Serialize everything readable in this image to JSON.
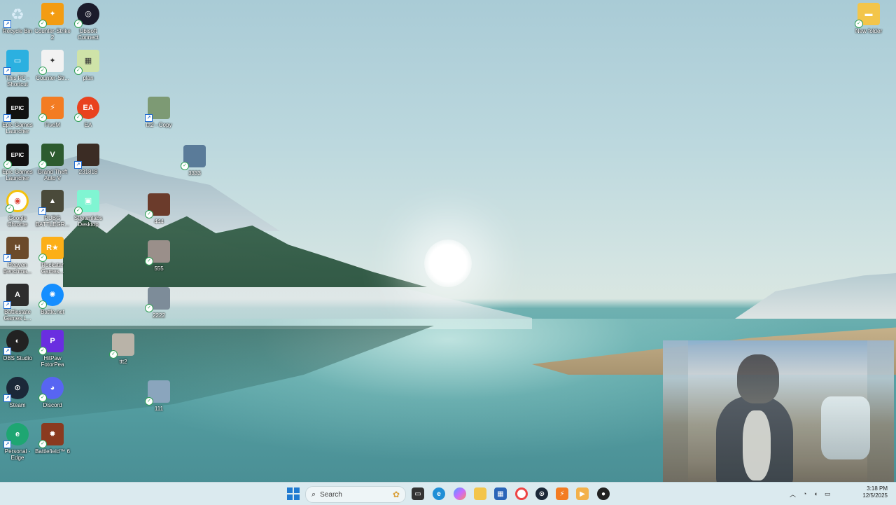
{
  "desktop": {
    "icons": [
      {
        "id": "recycle-bin",
        "label": "Recycle Bin",
        "icon": "recycle-bin-icon",
        "color": "#6aa8d8"
      },
      {
        "id": "counter-strike-2",
        "label": "Counter-Strike 2",
        "icon": "counter-strike-icon",
        "color": "#f39c12"
      },
      {
        "id": "ubisoft-connect",
        "label": "Ubisoft Connect",
        "icon": "ubisoft-swirl-icon",
        "color": "#1b1b2b"
      },
      {
        "id": "this-pc",
        "label": "This PC - Shortcut",
        "icon": "monitor-icon",
        "color": "#2bb0e0"
      },
      {
        "id": "counter-strike",
        "label": "Counter-Str...",
        "icon": "counter-strike-icon",
        "color": "#f2f2f2"
      },
      {
        "id": "plan",
        "label": "plan",
        "icon": "checker-image-icon",
        "color": "#cfe3a8"
      },
      {
        "id": "epic-games-1",
        "label": "Epic Games Launcher",
        "icon": "epic-games-icon",
        "color": "#111111"
      },
      {
        "id": "fivem",
        "label": "FiveM",
        "icon": "fivem-icon",
        "color": "#f37c22"
      },
      {
        "id": "ea",
        "label": "EA",
        "icon": "ea-icon",
        "color": "#e9421e"
      },
      {
        "id": "ttt2-copy",
        "label": "ttt2 - Copy",
        "icon": "photo-thumb-icon",
        "color": "#7d9a74"
      },
      {
        "id": "epic-games-2",
        "label": "Epic Games Launcher",
        "icon": "epic-games-icon",
        "color": "#111111"
      },
      {
        "id": "gta-v",
        "label": "Grand Theft Auto V",
        "icon": "gta-icon",
        "color": "#2d5b2f"
      },
      {
        "id": "231818",
        "label": "231818",
        "icon": "photo-thumb-icon",
        "color": "#3b2c24"
      },
      {
        "id": "3333",
        "label": "3333",
        "icon": "photo-thumb-icon",
        "color": "#5a7b99"
      },
      {
        "id": "google-chrome",
        "label": "Google Chrome",
        "icon": "chrome-icon",
        "color": "#ffffff"
      },
      {
        "id": "pubg",
        "label": "PUBG BATTLEGR...",
        "icon": "pubg-icon",
        "color": "#4a4a3a"
      },
      {
        "id": "streamlabs",
        "label": "Streamlabs Desktop",
        "icon": "streamlabs-icon",
        "color": "#80f5d2"
      },
      {
        "id": "444",
        "label": "444",
        "icon": "photo-thumb-icon",
        "color": "#6b3b2b"
      },
      {
        "id": "heaven",
        "label": "Heaven Benchma...",
        "icon": "heaven-icon",
        "color": "#6b4a2a"
      },
      {
        "id": "rockstar",
        "label": "Rockstar Games...",
        "icon": "rockstar-icon",
        "color": "#fcaf17"
      },
      {
        "id": "555",
        "label": "555",
        "icon": "photo-thumb-icon",
        "color": "#9a8f8a"
      },
      {
        "id": "battlestate",
        "label": "Battlestate Games L...",
        "icon": "battlestate-icon",
        "color": "#2d2d2d"
      },
      {
        "id": "battlenet",
        "label": "Battle.net",
        "icon": "battlenet-icon",
        "color": "#148eff"
      },
      {
        "id": "2222",
        "label": "2222",
        "icon": "photo-thumb-icon",
        "color": "#7d8c99"
      },
      {
        "id": "obs",
        "label": "OBS Studio",
        "icon": "obs-icon",
        "color": "#222222"
      },
      {
        "id": "hitpaw",
        "label": "HitPaw FotorPea",
        "icon": "hitpaw-icon",
        "color": "#6a2ee0"
      },
      {
        "id": "ttt2",
        "label": "ttt2",
        "icon": "photo-thumb-icon",
        "color": "#b9b3a8"
      },
      {
        "id": "steam",
        "label": "Steam",
        "icon": "steam-icon",
        "color": "#1b2838"
      },
      {
        "id": "discord",
        "label": "Discord",
        "icon": "discord-icon",
        "color": "#5865f2"
      },
      {
        "id": "111",
        "label": "111",
        "icon": "photo-thumb-icon",
        "color": "#8aa5bd"
      },
      {
        "id": "personal-edge",
        "label": "Personal - Edge",
        "icon": "edge-icon",
        "color": "#1ea672"
      },
      {
        "id": "battlefield-6",
        "label": "Battlefield™ 6",
        "icon": "battlefield-icon",
        "color": "#8a3a1f"
      },
      {
        "id": "new-folder",
        "label": "New folder",
        "icon": "folder-icon",
        "color": "#f3c54a"
      }
    ]
  },
  "taskbar": {
    "search_placeholder": "Search",
    "time": "3:18 PM",
    "date": "12/5/2025"
  }
}
